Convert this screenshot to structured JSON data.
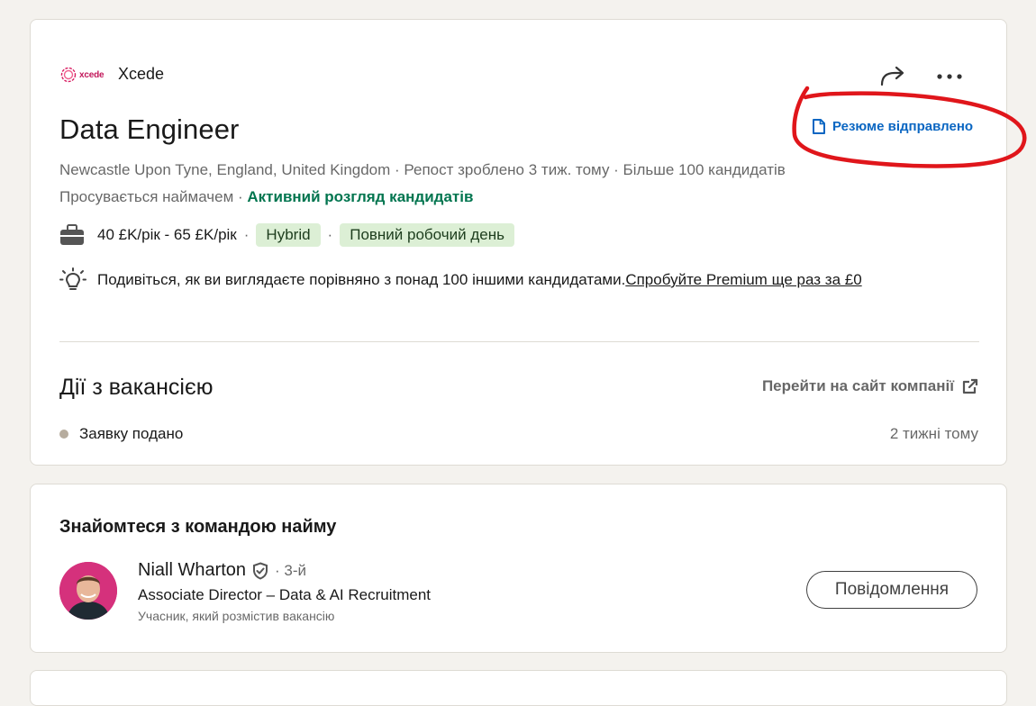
{
  "company": {
    "logo_text": "xcede",
    "name": "Xcede"
  },
  "job": {
    "title": "Data Engineer",
    "application_status": "Резюме відправлено",
    "meta": "Newcastle Upon Tyne, England, United Kingdom · Репост зроблено 3 тиж. тому · Більше 100 кандидатів",
    "promoted": "Просувається наймачем · ",
    "active_review": "Активний розгляд кандидатів",
    "salary": "40 £K/рік - 65 £K/рік",
    "separator": "·",
    "workplace_type": "Hybrid",
    "employment_type": "Повний робочий день",
    "insight_text": "Подивіться, як ви виглядаєте порівняно з понад 100 іншими кандидатами. ",
    "premium_link": "Спробуйте Premium ще раз за £0"
  },
  "activity": {
    "title": "Дії з вакансією",
    "company_site_link": "Перейти на сайт компанії",
    "status_label": "Заявку подано",
    "status_time": "2 тижні тому"
  },
  "team": {
    "title": "Знайомтеся з командою найму",
    "person": {
      "name": "Niall Wharton",
      "degree": "· 3-й",
      "headline": "Associate Director – Data & AI Recruitment",
      "role": "Учасник, який розмістив вакансію"
    },
    "message_button": "Повідомлення"
  },
  "colors": {
    "accent_blue": "#0a66c2",
    "active_green": "#01754f",
    "pill_green": "#dcefd5",
    "annotation_red": "#e0161b",
    "avatar_bg": "#d5317c"
  },
  "icons": [
    "xcede-logo-icon",
    "share-icon",
    "more-icon",
    "document-icon",
    "briefcase-icon",
    "lightbulb-icon",
    "external-link-icon",
    "verified-shield-icon"
  ]
}
